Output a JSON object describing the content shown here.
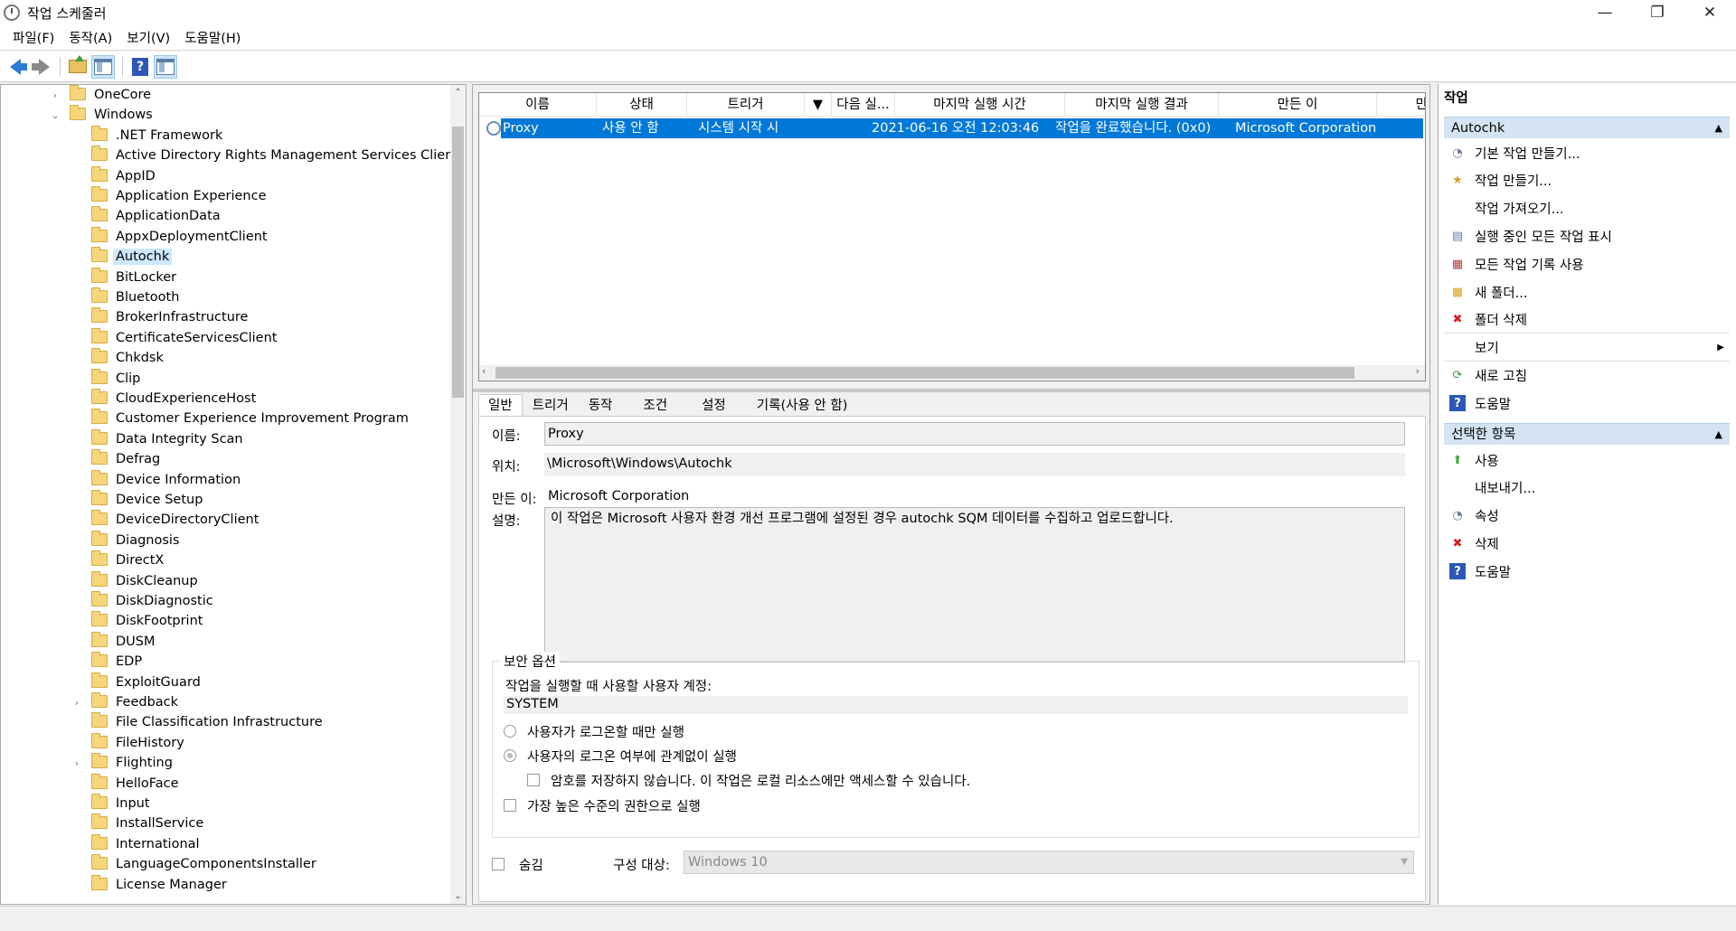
{
  "window": {
    "title": "작업 스케줄러"
  },
  "menu": [
    "파일(F)",
    "동작(A)",
    "보기(V)",
    "도움말(H)"
  ],
  "tree": {
    "items": [
      {
        "label": "OneCore",
        "expandable": true
      },
      {
        "label": "Windows",
        "expanded": true
      },
      {
        "label": ".NET Framework"
      },
      {
        "label": "Active Directory Rights Management Services Client"
      },
      {
        "label": "AppID"
      },
      {
        "label": "Application Experience"
      },
      {
        "label": "ApplicationData"
      },
      {
        "label": "AppxDeploymentClient"
      },
      {
        "label": "Autochk",
        "selected": true
      },
      {
        "label": "BitLocker"
      },
      {
        "label": "Bluetooth"
      },
      {
        "label": "BrokerInfrastructure"
      },
      {
        "label": "CertificateServicesClient"
      },
      {
        "label": "Chkdsk"
      },
      {
        "label": "Clip"
      },
      {
        "label": "CloudExperienceHost"
      },
      {
        "label": "Customer Experience Improvement Program"
      },
      {
        "label": "Data Integrity Scan"
      },
      {
        "label": "Defrag"
      },
      {
        "label": "Device Information"
      },
      {
        "label": "Device Setup"
      },
      {
        "label": "DeviceDirectoryClient"
      },
      {
        "label": "Diagnosis"
      },
      {
        "label": "DirectX"
      },
      {
        "label": "DiskCleanup"
      },
      {
        "label": "DiskDiagnostic"
      },
      {
        "label": "DiskFootprint"
      },
      {
        "label": "DUSM"
      },
      {
        "label": "EDP"
      },
      {
        "label": "ExploitGuard"
      },
      {
        "label": "Feedback",
        "expandable": true
      },
      {
        "label": "File Classification Infrastructure"
      },
      {
        "label": "FileHistory"
      },
      {
        "label": "Flighting",
        "expandable": true
      },
      {
        "label": "HelloFace"
      },
      {
        "label": "Input"
      },
      {
        "label": "InstallService"
      },
      {
        "label": "International"
      },
      {
        "label": "LanguageComponentsInstaller"
      },
      {
        "label": "License Manager"
      }
    ]
  },
  "task_list": {
    "columns": [
      "이름",
      "상태",
      "트리거",
      "다음 실...",
      "마지막 실행 시간",
      "마지막 실행 결과",
      "만든 이",
      "만"
    ],
    "rows": [
      {
        "name": "Proxy",
        "status": "사용 안 함",
        "trigger": "시스템 시작 시",
        "next_run": "",
        "last_run": "2021-06-16 오전 12:03:46",
        "last_result": "작업을 완료했습니다. (0x0)",
        "author": "Microsoft Corporation"
      }
    ]
  },
  "detail_tabs": [
    "일반",
    "트리거",
    "동작",
    "조건",
    "설정",
    "기록(사용 안 함)"
  ],
  "general": {
    "name_label": "이름:",
    "name_value": "Proxy",
    "location_label": "위치:",
    "location_value": "\\Microsoft\\Windows\\Autochk",
    "author_label": "만든 이:",
    "author_value": "Microsoft Corporation",
    "desc_label": "설명:",
    "desc_value": "이 작업은 Microsoft 사용자 환경 개선 프로그램에 설정된 경우 autochk SQM 데이터를 수집하고 업로드합니다.",
    "security_title": "보안 옵션",
    "account_label": "작업을 실행할 때 사용할 사용자 계정:",
    "account_value": "SYSTEM",
    "radio_logged_on": "사용자가 로그온할 때만 실행",
    "radio_whether": "사용자의 로그온 여부에 관계없이 실행",
    "check_no_password": "암호를 저장하지 않습니다. 이 작업은 로컬 리소스에만 액세스할 수 있습니다.",
    "check_highest": "가장 높은 수준의 권한으로 실행",
    "hidden_label": "숨김",
    "configure_label": "구성 대상:",
    "configure_value": "Windows 10"
  },
  "actions": {
    "title": "작업",
    "section1": "Autochk",
    "items1": [
      {
        "label": "기본 작업 만들기...",
        "icon": "wizard-icon"
      },
      {
        "label": "작업 만들기...",
        "icon": "task-icon"
      },
      {
        "label": "작업 가져오기...",
        "icon": ""
      },
      {
        "label": "실행 중인 모든 작업 표시",
        "icon": "running-icon"
      },
      {
        "label": "모든 작업 기록 사용",
        "icon": "history-icon"
      },
      {
        "label": "새 폴더...",
        "icon": "folder-icon"
      },
      {
        "label": "폴더 삭제",
        "icon": "delete-icon"
      },
      {
        "label": "보기",
        "icon": ""
      },
      {
        "label": "새로 고침",
        "icon": "refresh-icon"
      },
      {
        "label": "도움말",
        "icon": "help-icon"
      }
    ],
    "section2": "선택한 항목",
    "items2": [
      {
        "label": "사용",
        "icon": "enable-icon"
      },
      {
        "label": "내보내기...",
        "icon": ""
      },
      {
        "label": "속성",
        "icon": "properties-icon"
      },
      {
        "label": "삭제",
        "icon": "delete-icon"
      },
      {
        "label": "도움말",
        "icon": "help-icon"
      }
    ]
  },
  "colors": {
    "selection": "#0078d7",
    "section_header": "#d5e4f2",
    "tree_selection": "#cce8ff"
  }
}
